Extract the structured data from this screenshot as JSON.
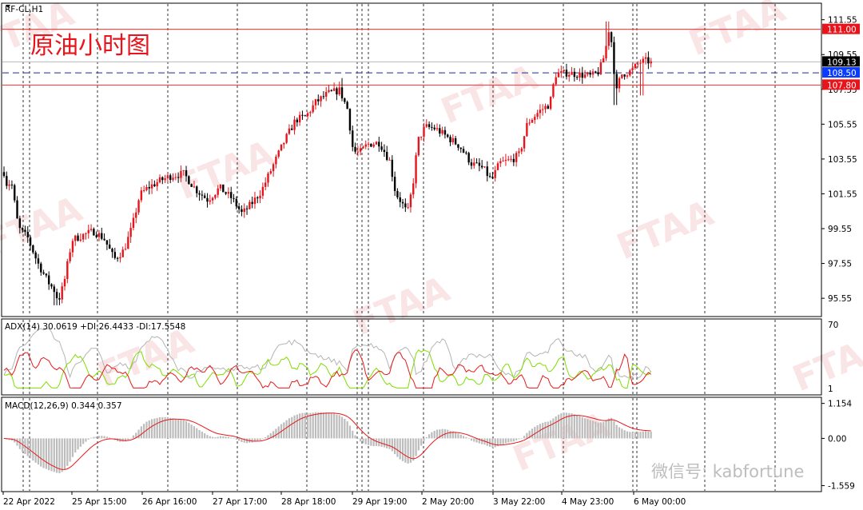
{
  "window": {
    "symbol": "RF-CL,H1",
    "title_cn": "原油小时图",
    "wechat_text": "微信号: kabfortune",
    "watermark": "FTAA"
  },
  "price_panel": {
    "ylim": [
      94.5,
      112.5
    ],
    "ticks": [
      "111.55",
      "109.55",
      "107.55",
      "105.55",
      "103.55",
      "101.55",
      "99.55",
      "97.55",
      "95.55"
    ],
    "tick_values": [
      111.55,
      109.55,
      107.55,
      105.55,
      103.55,
      101.55,
      99.55,
      97.55,
      95.55
    ],
    "hlines": [
      {
        "value": 111.0,
        "label": "111.00",
        "color": "#ff2a2a",
        "style": "solid",
        "tag_color": "#e8141b"
      },
      {
        "value": 108.5,
        "label": "108.50",
        "color": "#1a2a8c",
        "style": "dashed",
        "tag_color": "#0a3cff"
      },
      {
        "value": 107.8,
        "label": "107.80",
        "color": "#ff2a2a",
        "style": "solid",
        "tag_color": "#e8141b"
      }
    ],
    "current_price": {
      "value": 109.13,
      "label": "109.13",
      "tag_color": "#000000"
    },
    "grey_line": 109.13
  },
  "adx_panel": {
    "label": "ADX(14) 30.0619 +DI:26.4433 -DI:17.5548",
    "ticks": [
      "70",
      "1"
    ],
    "tick_values": [
      70,
      1
    ],
    "ylim": [
      0,
      75
    ],
    "colors": {
      "adx": "#b4b4b4",
      "plus_di": "#7fdd00",
      "minus_di": "#e81818"
    }
  },
  "macd_panel": {
    "label": "MACD(12,26,9) 0.344 0.357",
    "ticks": [
      "1.154",
      "0.00",
      "-1.559"
    ],
    "tick_values": [
      1.154,
      0.0,
      -1.559
    ],
    "ylim": [
      -1.65,
      1.25
    ],
    "colors": {
      "hist": "#bcbcbc",
      "signal": "#e81818"
    }
  },
  "time_axis": {
    "labels": [
      "22 Apr 2022",
      "25 Apr 15:00",
      "26 Apr 16:00",
      "27 Apr 17:00",
      "28 Apr 18:00",
      "29 Apr 19:00",
      "2 May 20:00",
      "3 May 22:00",
      "4 May 23:00",
      "6 May 00:00"
    ]
  },
  "chart_data": {
    "type": "candlestick",
    "title": "原油小时图",
    "symbol": "RF-CL,H1",
    "series_note": "hourly OHLC, approximate key swing points",
    "key_points": [
      {
        "x": "22 Apr 2022",
        "y": 102.8
      },
      {
        "x": "25 Apr 15:00",
        "y": 95.2
      },
      {
        "x": "26 Apr 16:00",
        "y": 102.5
      },
      {
        "x": "27 Apr 17:00",
        "y": 100.3
      },
      {
        "x": "28 Apr 18:00",
        "y": 108.2
      },
      {
        "x": "29 Apr 19:00",
        "y": 104.0
      },
      {
        "x": "2 May 20:00",
        "y": 100.2
      },
      {
        "x": "2 May 20:00",
        "y": 105.6
      },
      {
        "x": "3 May 22:00",
        "y": 102.2
      },
      {
        "x": "4 May 23:00",
        "y": 108.5
      },
      {
        "x": "4 May 23:00",
        "y": 111.4
      },
      {
        "x": "6 May 00:00",
        "y": 106.7
      },
      {
        "x": "6 May 00:00",
        "y": 109.13
      }
    ],
    "levels": [
      111.0,
      108.5,
      107.8
    ],
    "last_price": 109.13,
    "indicators": {
      "adx": {
        "period": 14,
        "adx": 30.0619,
        "plus_di": 26.4433,
        "minus_di": 17.5548
      },
      "macd": {
        "params": [
          12,
          26,
          9
        ],
        "main": 0.344,
        "signal": 0.357
      }
    }
  }
}
